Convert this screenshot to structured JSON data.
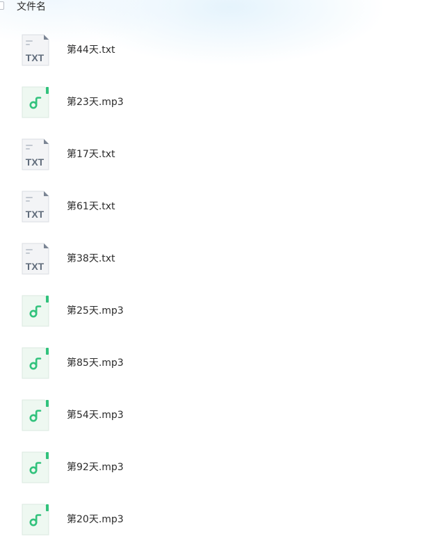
{
  "header": {
    "column_label": "文件名"
  },
  "files": [
    {
      "name": "第44天.txt",
      "type": "txt",
      "icon": "txt-file-icon",
      "icon_label": "TXT"
    },
    {
      "name": "第23天.mp3",
      "type": "mp3",
      "icon": "audio-file-icon"
    },
    {
      "name": "第17天.txt",
      "type": "txt",
      "icon": "txt-file-icon",
      "icon_label": "TXT"
    },
    {
      "name": "第61天.txt",
      "type": "txt",
      "icon": "txt-file-icon",
      "icon_label": "TXT"
    },
    {
      "name": "第38天.txt",
      "type": "txt",
      "icon": "txt-file-icon",
      "icon_label": "TXT"
    },
    {
      "name": "第25天.mp3",
      "type": "mp3",
      "icon": "audio-file-icon"
    },
    {
      "name": "第85天.mp3",
      "type": "mp3",
      "icon": "audio-file-icon"
    },
    {
      "name": "第54天.mp3",
      "type": "mp3",
      "icon": "audio-file-icon"
    },
    {
      "name": "第92天.mp3",
      "type": "mp3",
      "icon": "audio-file-icon"
    },
    {
      "name": "第20天.mp3",
      "type": "mp3",
      "icon": "audio-file-icon"
    }
  ],
  "colors": {
    "txt_icon_bg": "#f3f4f6",
    "txt_icon_text": "#5f6b7a",
    "audio_icon_bg": "#eef8f1",
    "audio_accent": "#31c27c"
  }
}
